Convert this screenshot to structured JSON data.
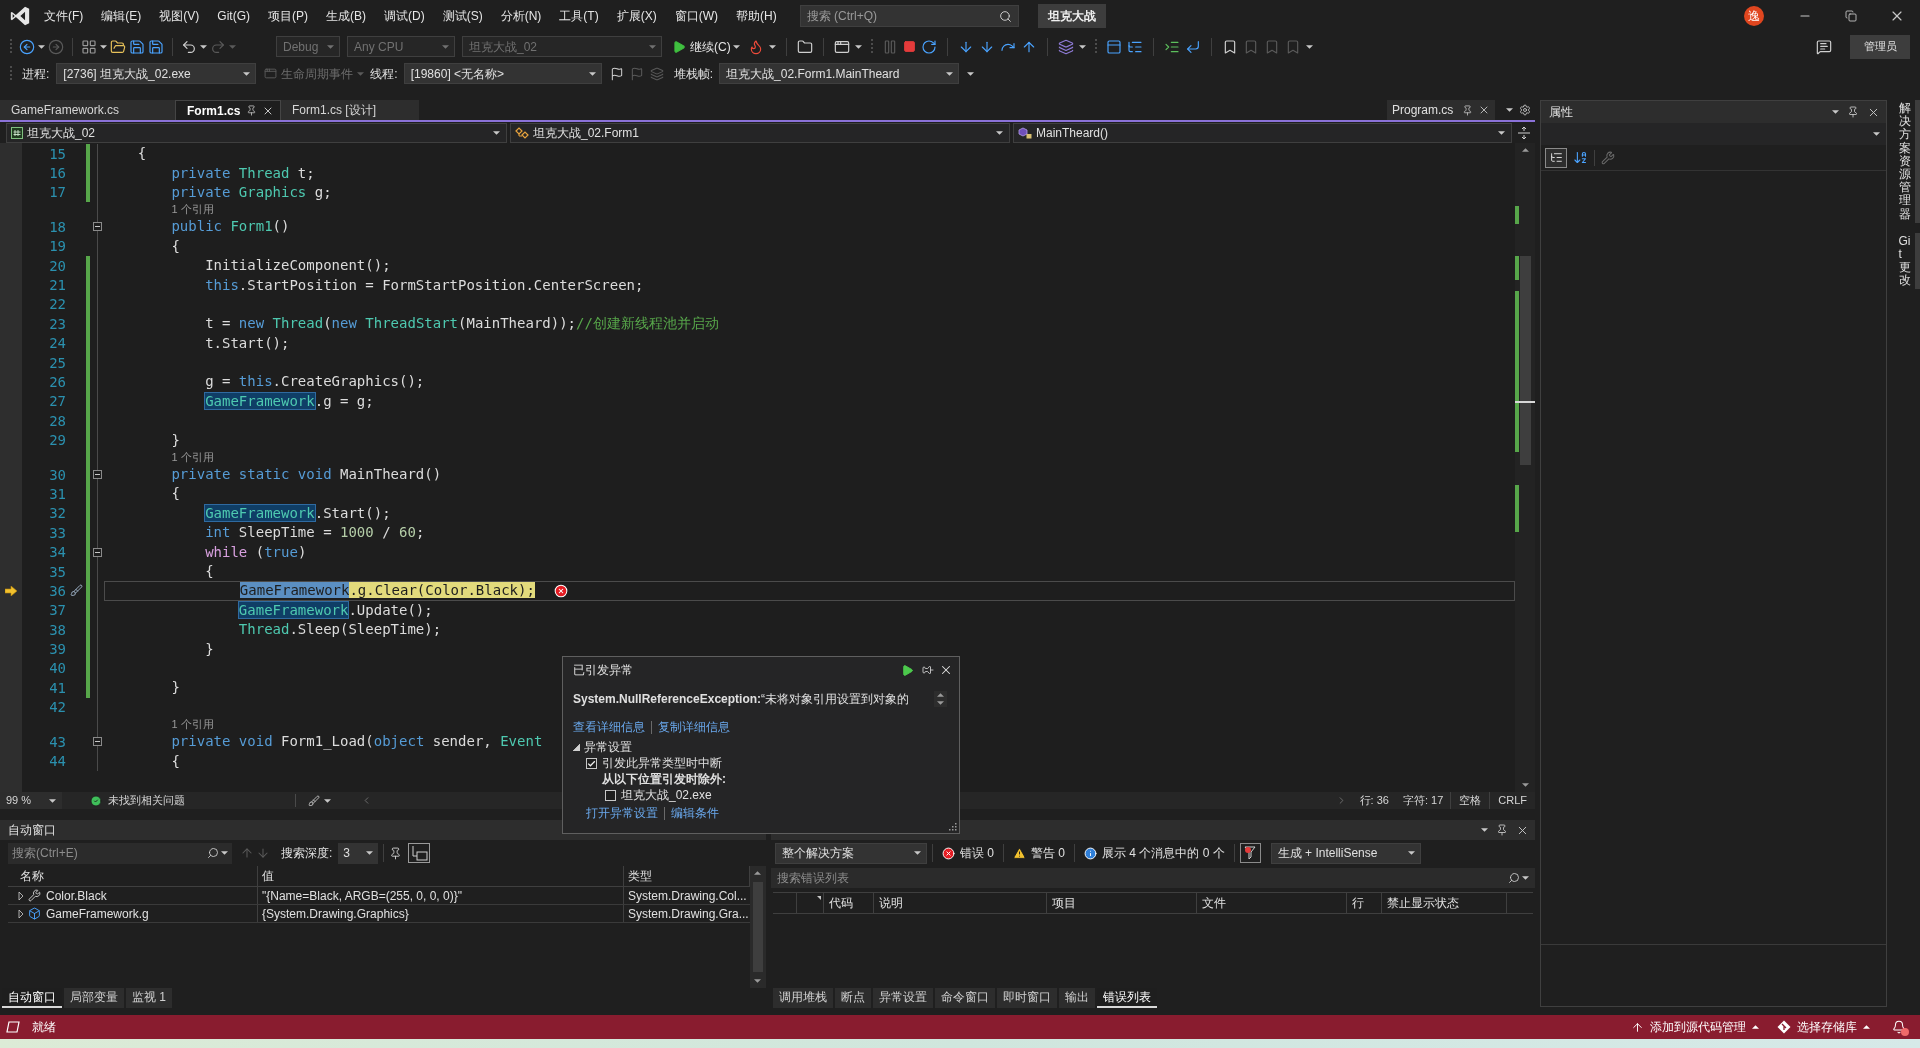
{
  "menu_bar": {
    "items": [
      "文件(F)",
      "编辑(E)",
      "视图(V)",
      "Git(G)",
      "项目(P)",
      "生成(B)",
      "调试(D)",
      "测试(S)",
      "分析(N)",
      "工具(T)",
      "扩展(X)",
      "窗口(W)",
      "帮助(H)"
    ],
    "search": {
      "placeholder": "搜索 (Ctrl+Q)"
    },
    "solution_name": "坦克大战",
    "account_initial": "逸"
  },
  "toolbar": {
    "combos": [
      {
        "text": "Debug",
        "disabled": true
      },
      {
        "text": "Any CPU",
        "disabled": true
      },
      {
        "text": "坦克大战_02",
        "disabled": true
      }
    ],
    "continue_button": "继续(C)",
    "admin_button": "管理员"
  },
  "debug_location": {
    "process_label": "进程:",
    "process": "[2736] 坦克大战_02.exe",
    "lifecycle_events": {
      "label": "生命周期事件",
      "disabled": true
    },
    "thread_label": "线程:",
    "thread": "[19860] <无名称>",
    "stack_frame_label": "堆栈帧:",
    "stack_frame": "坦克大战_02.Form1.MainTheard"
  },
  "document_tabs": [
    {
      "label": "GameFramework.cs",
      "selected": false
    },
    {
      "label": "Form1.cs",
      "selected": true
    },
    {
      "label": "Form1.cs [设计]",
      "selected": false
    }
  ],
  "preview_tab": {
    "label": "Program.cs"
  },
  "navigation_bar": {
    "project": "坦克大战_02",
    "type": "坦克大战_02.Form1",
    "member": "MainTheard()"
  },
  "editor": {
    "lines": [
      {
        "number": "15",
        "changed": true,
        "current": false,
        "collapsible": false,
        "tokens": [
          {
            "kind": "plain",
            "text": "    {"
          }
        ]
      },
      {
        "number": "16",
        "changed": true,
        "current": false,
        "collapsible": false,
        "tokens": [
          {
            "kind": "keyword",
            "text": "        private "
          },
          {
            "kind": "type",
            "text": "Thread"
          },
          {
            "kind": "plain",
            "text": " t;"
          }
        ]
      },
      {
        "number": "17",
        "changed": true,
        "current": false,
        "collapsible": false,
        "tokens": [
          {
            "kind": "keyword",
            "text": "        private "
          },
          {
            "kind": "type",
            "text": "Graphics"
          },
          {
            "kind": "plain",
            "text": " g;"
          }
        ]
      },
      {
        "number": "18",
        "changed": false,
        "current": false,
        "collapsible": true,
        "codelens": "1 个引用",
        "tokens": [
          {
            "kind": "keyword",
            "text": "        public "
          },
          {
            "kind": "type",
            "text": "Form1"
          },
          {
            "kind": "plain",
            "text": "()"
          }
        ]
      },
      {
        "number": "19",
        "changed": false,
        "current": false,
        "collapsible": false,
        "tokens": [
          {
            "kind": "plain",
            "text": "        {"
          }
        ]
      },
      {
        "number": "20",
        "changed": true,
        "current": false,
        "collapsible": false,
        "tokens": [
          {
            "kind": "plain",
            "text": "            InitializeComponent();"
          }
        ]
      },
      {
        "number": "21",
        "changed": true,
        "current": false,
        "collapsible": false,
        "tokens": [
          {
            "kind": "keyword",
            "text": "            this"
          },
          {
            "kind": "plain",
            "text": ".StartPosition = FormStartPosition.CenterScreen;"
          }
        ]
      },
      {
        "number": "22",
        "changed": true,
        "current": false,
        "collapsible": false
      },
      {
        "number": "23",
        "changed": true,
        "current": false,
        "collapsible": false,
        "tokens": [
          {
            "kind": "plain",
            "text": "            t = "
          },
          {
            "kind": "keyword",
            "text": "new "
          },
          {
            "kind": "type",
            "text": "Thread"
          },
          {
            "kind": "plain",
            "text": "("
          },
          {
            "kind": "keyword",
            "text": "new "
          },
          {
            "kind": "type",
            "text": "ThreadStart"
          },
          {
            "kind": "plain",
            "text": "(MainTheard));"
          },
          {
            "kind": "comment",
            "text": "//创建新线程池并启动"
          }
        ]
      },
      {
        "number": "24",
        "changed": true,
        "current": false,
        "collapsible": false,
        "tokens": [
          {
            "kind": "plain",
            "text": "            t.Start();"
          }
        ]
      },
      {
        "number": "25",
        "changed": true,
        "current": false,
        "collapsible": false
      },
      {
        "number": "26",
        "changed": true,
        "current": false,
        "collapsible": false,
        "tokens": [
          {
            "kind": "plain",
            "text": "            g = "
          },
          {
            "kind": "keyword",
            "text": "this"
          },
          {
            "kind": "plain",
            "text": ".CreateGraphics();"
          }
        ]
      },
      {
        "number": "27",
        "changed": true,
        "current": false,
        "collapsible": false,
        "tokens": [
          {
            "kind": "reference",
            "text": "            GameFramework"
          },
          {
            "kind": "plain",
            "text": ".g = g;"
          }
        ]
      },
      {
        "number": "28",
        "changed": true,
        "current": false,
        "collapsible": false
      },
      {
        "number": "29",
        "changed": true,
        "current": false,
        "collapsible": false,
        "tokens": [
          {
            "kind": "plain",
            "text": "        }"
          }
        ]
      },
      {
        "number": "30",
        "changed": true,
        "current": false,
        "collapsible": true,
        "codelens": "1 个引用",
        "tokens": [
          {
            "kind": "keyword",
            "text": "        private static void"
          },
          {
            "kind": "plain",
            "text": " MainTheard()"
          }
        ]
      },
      {
        "number": "31",
        "changed": true,
        "current": false,
        "collapsible": false,
        "tokens": [
          {
            "kind": "plain",
            "text": "        {"
          }
        ]
      },
      {
        "number": "32",
        "changed": true,
        "current": false,
        "collapsible": false,
        "tokens": [
          {
            "kind": "reference",
            "text": "            GameFramework"
          },
          {
            "kind": "plain",
            "text": ".Start();"
          }
        ]
      },
      {
        "number": "33",
        "changed": true,
        "current": false,
        "collapsible": false,
        "tokens": [
          {
            "kind": "keyword",
            "text": "            int"
          },
          {
            "kind": "plain",
            "text": " SleepTime = "
          },
          {
            "kind": "number",
            "text": "1000"
          },
          {
            "kind": "plain",
            "text": " / "
          },
          {
            "kind": "number",
            "text": "60"
          },
          {
            "kind": "plain",
            "text": ";"
          }
        ]
      },
      {
        "number": "34",
        "changed": true,
        "current": false,
        "collapsible": true,
        "tokens": [
          {
            "kind": "control",
            "text": "            while"
          },
          {
            "kind": "plain",
            "text": " ("
          },
          {
            "kind": "keyword",
            "text": "true"
          },
          {
            "kind": "plain",
            "text": ")"
          }
        ]
      },
      {
        "number": "35",
        "changed": true,
        "current": false,
        "collapsible": false,
        "tokens": [
          {
            "kind": "plain",
            "text": "            {"
          }
        ]
      },
      {
        "number": "36",
        "changed": true,
        "current": true,
        "collapsible": false,
        "tokens": [
          {
            "kind": "current_reference",
            "text": "                GameFramework"
          },
          {
            "kind": "current",
            "text": ".g.Clear(Color.Black);"
          }
        ]
      },
      {
        "number": "37",
        "changed": true,
        "current": false,
        "collapsible": false,
        "tokens": [
          {
            "kind": "reference",
            "text": "                GameFramework"
          },
          {
            "kind": "plain",
            "text": ".Update();"
          }
        ]
      },
      {
        "number": "38",
        "changed": true,
        "current": false,
        "collapsible": false,
        "tokens": [
          {
            "kind": "type",
            "text": "                Thread"
          },
          {
            "kind": "plain",
            "text": ".Sleep(SleepTime);"
          }
        ]
      },
      {
        "number": "39",
        "changed": true,
        "current": false,
        "collapsible": false,
        "tokens": [
          {
            "kind": "plain",
            "text": "            }"
          }
        ]
      },
      {
        "number": "40",
        "changed": true,
        "current": false,
        "collapsible": false
      },
      {
        "number": "41",
        "changed": true,
        "current": false,
        "collapsible": false,
        "tokens": [
          {
            "kind": "plain",
            "text": "        }"
          }
        ]
      },
      {
        "number": "42",
        "changed": false,
        "current": false,
        "collapsible": false
      },
      {
        "number": "43",
        "changed": false,
        "current": false,
        "collapsible": true,
        "codelens": "1 个引用",
        "tokens": [
          {
            "kind": "keyword",
            "text": "        private void"
          },
          {
            "kind": "plain",
            "text": " Form1_Load("
          },
          {
            "kind": "keyword",
            "text": "object"
          },
          {
            "kind": "plain",
            "text": " sender, "
          },
          {
            "kind": "type",
            "text": "Event"
          }
        ]
      },
      {
        "number": "44",
        "changed": false,
        "current": false,
        "collapsible": false,
        "tokens": [
          {
            "kind": "plain",
            "text": "        {"
          }
        ]
      }
    ],
    "status": {
      "zoom": "99 %",
      "issues": "未找到相关问题",
      "line": "行: 36",
      "column": "字符: 17",
      "whitespace": "空格",
      "line_ending": "CRLF"
    }
  },
  "exception_popup": {
    "title": "已引发异常",
    "message": "**System.NullReferenceException:**“未将对象引用设置到对象的",
    "links": [
      "查看详细信息",
      "复制详细信息"
    ],
    "settings": {
      "label": "异常设置",
      "expanded": true,
      "break_option": {
        "label": "引发此异常类型时中断",
        "checked": true
      },
      "except_label": "从以下位置引发时除外:",
      "exceptions": [
        {
          "label": "坦克大战_02.exe",
          "checked": false
        }
      ]
    },
    "footer_links": [
      "打开异常设置",
      "编辑条件"
    ]
  },
  "autos_window": {
    "title": "自动窗口",
    "search": {
      "placeholder": "搜索(Ctrl+E)"
    },
    "depth_label": "搜索深度:",
    "depth": "3",
    "columns": [
      "名称",
      "值",
      "类型"
    ],
    "rows": [
      {
        "kind": "property",
        "name": "Color.Black",
        "value": "\"{Name=Black, ARGB=(255, 0, 0, 0)}\"",
        "type": "System.Drawing.Col...",
        "expanded": false
      },
      {
        "kind": "field",
        "name": "GameFramework.g",
        "value": "{System.Drawing.Graphics}",
        "type": "System.Drawing.Gra...",
        "expanded": false
      }
    ],
    "tabs": [
      {
        "label": "自动窗口",
        "selected": true
      },
      {
        "label": "局部变量",
        "selected": false
      },
      {
        "label": "监视 1",
        "selected": false
      }
    ]
  },
  "error_list": {
    "scope": "整个解决方案",
    "errors": "错误 0",
    "warnings": "警告 0",
    "messages": "展示 4 个消息中的 0 个",
    "source": "生成 + IntelliSense",
    "search": {
      "placeholder": "搜索错误列表"
    },
    "columns": [
      "代码",
      "说明",
      "项目",
      "文件",
      "行",
      "禁止显示状态"
    ],
    "tabs": [
      {
        "label": "调用堆栈",
        "selected": false
      },
      {
        "label": "断点",
        "selected": false
      },
      {
        "label": "异常设置",
        "selected": false
      },
      {
        "label": "命令窗口",
        "selected": false
      },
      {
        "label": "即时窗口",
        "selected": false
      },
      {
        "label": "输出",
        "selected": false
      },
      {
        "label": "错误列表",
        "selected": true
      }
    ]
  },
  "properties_panel": {
    "title": "属性"
  },
  "side_tabs": [
    "解决方案资源管理器",
    "Git 更改"
  ],
  "status_bar": {
    "message": "就绪",
    "items": [
      "添加到源代码管理",
      "选择存储库"
    ]
  }
}
